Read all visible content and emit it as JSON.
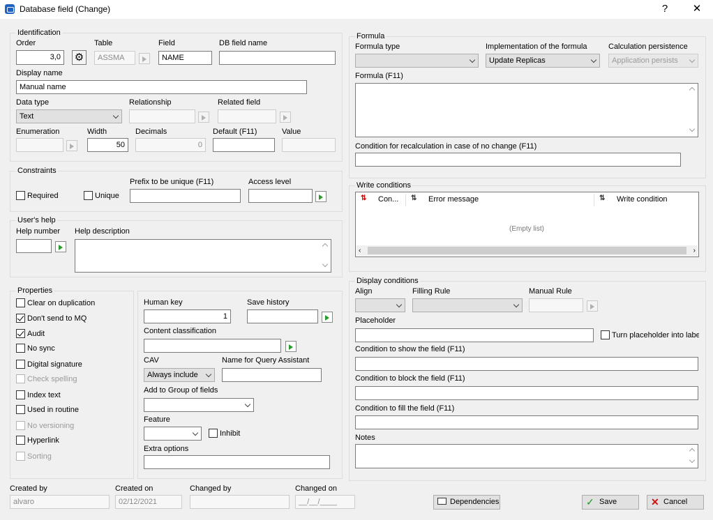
{
  "window": {
    "title": "Database field (Change)",
    "help_label": "?",
    "close_label": "✕"
  },
  "identification": {
    "group": "Identification",
    "order_label": "Order",
    "order_value": "3,0",
    "table_label": "Table",
    "table_value": "ASSMA",
    "field_label": "Field",
    "field_value": "NAME",
    "dbfield_label": "DB field name",
    "dbfield_value": "",
    "display_name_label": "Display name",
    "display_name_value": "Manual name",
    "data_type_label": "Data type",
    "data_type_value": "Text",
    "relationship_label": "Relationship",
    "relationship_value": "",
    "related_field_label": "Related field",
    "related_field_value": "",
    "enumeration_label": "Enumeration",
    "enumeration_value": "",
    "width_label": "Width",
    "width_value": "50",
    "decimals_label": "Decimals",
    "decimals_value": "0",
    "default_label": "Default (F11)",
    "default_value": "",
    "value_label": "Value",
    "value_value": ""
  },
  "constraints": {
    "group": "Constraints",
    "required_label": "Required",
    "required_checked": false,
    "unique_label": "Unique",
    "unique_checked": false,
    "prefix_label": "Prefix to be unique (F11)",
    "prefix_value": "",
    "access_label": "Access level",
    "access_value": ""
  },
  "user_help": {
    "group": "User's help",
    "help_number_label": "Help number",
    "help_number_value": "",
    "help_desc_label": "Help description",
    "help_desc_value": ""
  },
  "properties": {
    "group": "Properties",
    "items": [
      {
        "label": "Clear on duplication",
        "checked": false,
        "disabled": false
      },
      {
        "label": "Don't send to MQ",
        "checked": true,
        "disabled": false
      },
      {
        "label": "Audit",
        "checked": true,
        "disabled": false
      },
      {
        "label": "No sync",
        "checked": false,
        "disabled": false
      },
      {
        "label": "Digital signature",
        "checked": false,
        "disabled": false
      },
      {
        "label": "Check spelling",
        "checked": false,
        "disabled": true
      },
      {
        "label": "Index text",
        "checked": false,
        "disabled": false
      },
      {
        "label": "Used in routine",
        "checked": false,
        "disabled": false
      },
      {
        "label": "No versioning",
        "checked": false,
        "disabled": true
      },
      {
        "label": "Hyperlink",
        "checked": false,
        "disabled": false
      },
      {
        "label": "Sorting",
        "checked": false,
        "disabled": true
      }
    ]
  },
  "extra": {
    "human_key_label": "Human key",
    "human_key_value": "1",
    "save_history_label": "Save history",
    "save_history_value": "",
    "content_class_label": "Content classification",
    "content_class_value": "",
    "cav_label": "CAV",
    "cav_value": "Always include",
    "query_name_label": "Name for Query Assistant",
    "query_name_value": "",
    "add_group_label": "Add to Group of fields",
    "add_group_value": "",
    "feature_label": "Feature",
    "feature_value": "",
    "inhibit_label": "Inhibit",
    "inhibit_checked": false,
    "extra_options_label": "Extra options",
    "extra_options_value": ""
  },
  "formula": {
    "group": "Formula",
    "type_label": "Formula type",
    "type_value": "",
    "impl_label": "Implementation of the formula",
    "impl_value": "Update Replicas",
    "persist_label": "Calculation persistence",
    "persist_value": "Application persists",
    "formula_label": "Formula (F11)",
    "formula_value": "",
    "recalc_label": "Condition for recalculation in case of no change (F11)",
    "recalc_value": ""
  },
  "write_conditions": {
    "group": "Write conditions",
    "columns": [
      "Con...",
      "Error message",
      "Write condition"
    ],
    "empty_text": "(Empty list)"
  },
  "display_conditions": {
    "group": "Display conditions",
    "align_label": "Align",
    "align_value": "",
    "filling_label": "Filling Rule",
    "filling_value": "",
    "manual_label": "Manual Rule",
    "manual_value": "",
    "placeholder_label": "Placeholder",
    "placeholder_value": "",
    "turn_placeholder_label": "Turn placeholder into label",
    "turn_placeholder_checked": false,
    "show_label": "Condition to show the field (F11)",
    "show_value": "",
    "block_label": "Condition to block the field (F11)",
    "block_value": "",
    "fill_label": "Condition to fill the field (F11)",
    "fill_value": "",
    "notes_label": "Notes",
    "notes_value": ""
  },
  "footer": {
    "created_by_label": "Created by",
    "created_by_value": "alvaro",
    "created_on_label": "Created on",
    "created_on_value": "02/12/2021",
    "changed_by_label": "Changed by",
    "changed_by_value": "",
    "changed_on_label": "Changed on",
    "changed_on_value": "__/__/____",
    "dependencies_label": "Dependencies",
    "save_label": "Save",
    "cancel_label": "Cancel"
  },
  "colors": {
    "window_bg": "#f0f0f0",
    "title_icon": "#1e63c4",
    "lookup_arrow": "#2a9a2a",
    "cancel_x": "#d01010",
    "save_check": "#1a9a1a"
  }
}
